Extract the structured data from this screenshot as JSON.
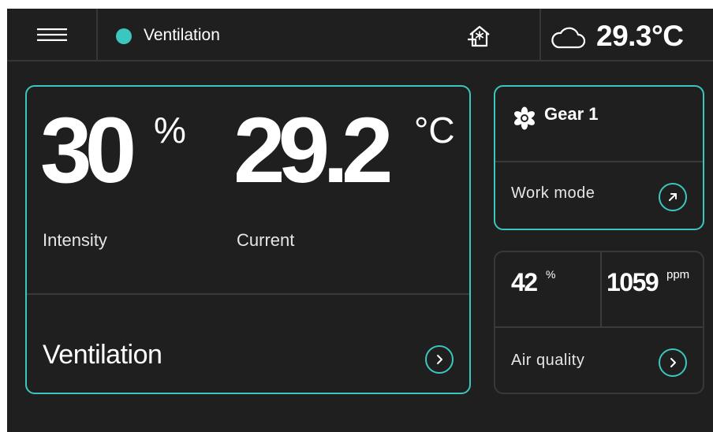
{
  "topbar": {
    "mode_label": "Ventilation",
    "outdoor_temperature": "29.3°C",
    "menu_icon": "hamburger-menu-icon",
    "home_icon": "home-snowflake-icon",
    "weather_icon": "cloud-icon",
    "status_dot_color": "#3bc7c0"
  },
  "main_card": {
    "intensity": {
      "value": "30",
      "unit": "%",
      "label": "Intensity"
    },
    "current_temperature": {
      "value": "29.2",
      "unit": "°C",
      "label": "Current"
    },
    "title": "Ventilation",
    "action_icon": "chevron-right-icon"
  },
  "gear_card": {
    "gear_label": "Gear 1",
    "gear_icon": "fan-icon",
    "work_mode_label": "Work mode",
    "action_icon": "arrow-up-right-icon"
  },
  "air_card": {
    "humidity": {
      "value": "42",
      "unit": "%"
    },
    "co2": {
      "value": "1059",
      "unit": "ppm"
    },
    "label": "Air quality",
    "action_icon": "chevron-right-icon"
  },
  "colors": {
    "accent": "#3bc7c0",
    "background": "#1f1f1f",
    "divider": "#363636",
    "text": "#ffffff"
  }
}
